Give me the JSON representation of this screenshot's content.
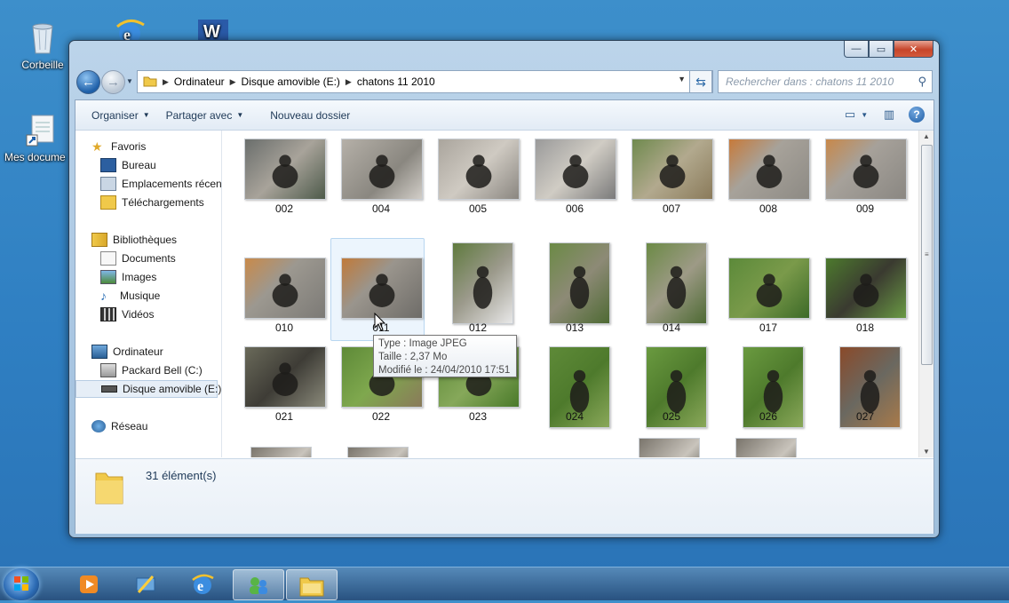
{
  "desktop": {
    "icons": [
      {
        "label": "Corbeille",
        "icon": "recycle-bin-icon"
      },
      {
        "label": "",
        "icon": "internet-explorer-icon"
      },
      {
        "label": "",
        "icon": "word-icon"
      },
      {
        "label": "Mes docume",
        "icon": "documents-shortcut-icon"
      }
    ]
  },
  "window": {
    "caption": {
      "minimize": "—",
      "maximize": "▭",
      "close": "✕"
    },
    "address": {
      "crumbs": [
        "Ordinateur",
        "Disque amovible (E:)",
        "chatons 11 2010"
      ]
    },
    "search": {
      "placeholder": "Rechercher dans : chatons 11 2010"
    },
    "toolbar": {
      "organize": "Organiser",
      "share": "Partager avec",
      "new_folder": "Nouveau dossier"
    },
    "sidebar": {
      "favorites": "Favoris",
      "fav_items": [
        "Bureau",
        "Emplacements récent",
        "Téléchargements"
      ],
      "libraries": "Bibliothèques",
      "lib_items": [
        "Documents",
        "Images",
        "Musique",
        "Vidéos"
      ],
      "computer": "Ordinateur",
      "comp_items": [
        "Packard Bell (C:)",
        "Disque amovible (E:)"
      ],
      "network": "Réseau"
    },
    "files": [
      "002",
      "004",
      "005",
      "006",
      "007",
      "008",
      "009",
      "010",
      "011",
      "012",
      "013",
      "014",
      "017",
      "018",
      "021",
      "022",
      "023",
      "024",
      "025",
      "026",
      "027"
    ],
    "tooltip": {
      "type": "Type : Image JPEG",
      "size": "Taille : 2,37 Mo",
      "modified": "Modifié le : 24/04/2010 17:51"
    },
    "details": {
      "count": "31 élément(s)"
    }
  },
  "taskbar": {
    "apps": [
      "media-player-icon",
      "network-tool-icon",
      "internet-explorer-icon",
      "messenger-icon",
      "explorer-folder-icon"
    ]
  }
}
